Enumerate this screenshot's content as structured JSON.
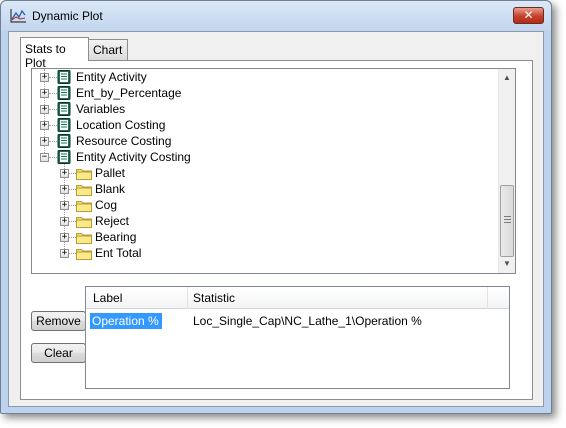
{
  "window": {
    "title": "Dynamic Plot",
    "close_glyph": "✕",
    "icon": "plot-chart-icon"
  },
  "tabs": [
    {
      "label": "Stats to Plot",
      "active": true
    },
    {
      "label": "Chart",
      "active": false
    }
  ],
  "tree": {
    "items": [
      {
        "label": "Entity Activity",
        "icon": "stat-book-icon",
        "expander": "+"
      },
      {
        "label": "Ent_by_Percentage",
        "icon": "stat-book-icon",
        "expander": "+"
      },
      {
        "label": "Variables",
        "icon": "stat-book-icon",
        "expander": "+"
      },
      {
        "label": "Location Costing",
        "icon": "stat-book-icon",
        "expander": "+"
      },
      {
        "label": "Resource Costing",
        "icon": "stat-book-icon",
        "expander": "+"
      },
      {
        "label": "Entity Activity Costing",
        "icon": "stat-book-icon",
        "expander": "−"
      }
    ],
    "children": [
      {
        "label": "Pallet",
        "icon": "folder-icon",
        "expander": "+"
      },
      {
        "label": "Blank",
        "icon": "folder-icon",
        "expander": "+"
      },
      {
        "label": "Cog",
        "icon": "folder-icon",
        "expander": "+"
      },
      {
        "label": "Reject",
        "icon": "folder-icon",
        "expander": "+"
      },
      {
        "label": "Bearing",
        "icon": "folder-icon",
        "expander": "+"
      },
      {
        "label": "Ent Total",
        "icon": "folder-icon",
        "expander": "+"
      }
    ],
    "scroll": {
      "up_glyph": "▲",
      "down_glyph": "▼"
    }
  },
  "buttons": {
    "remove": "Remove",
    "clear": "Clear"
  },
  "grid": {
    "columns": [
      "Label",
      "Statistic"
    ],
    "rows": [
      {
        "label": "Operation %",
        "statistic": "Loc_Single_Cap\\NC_Lathe_1\\Operation %",
        "selected": true
      }
    ]
  },
  "colors": {
    "selection": "#3399ff",
    "close_button": "#c6402c",
    "window_frame": "#bcd3ee"
  }
}
